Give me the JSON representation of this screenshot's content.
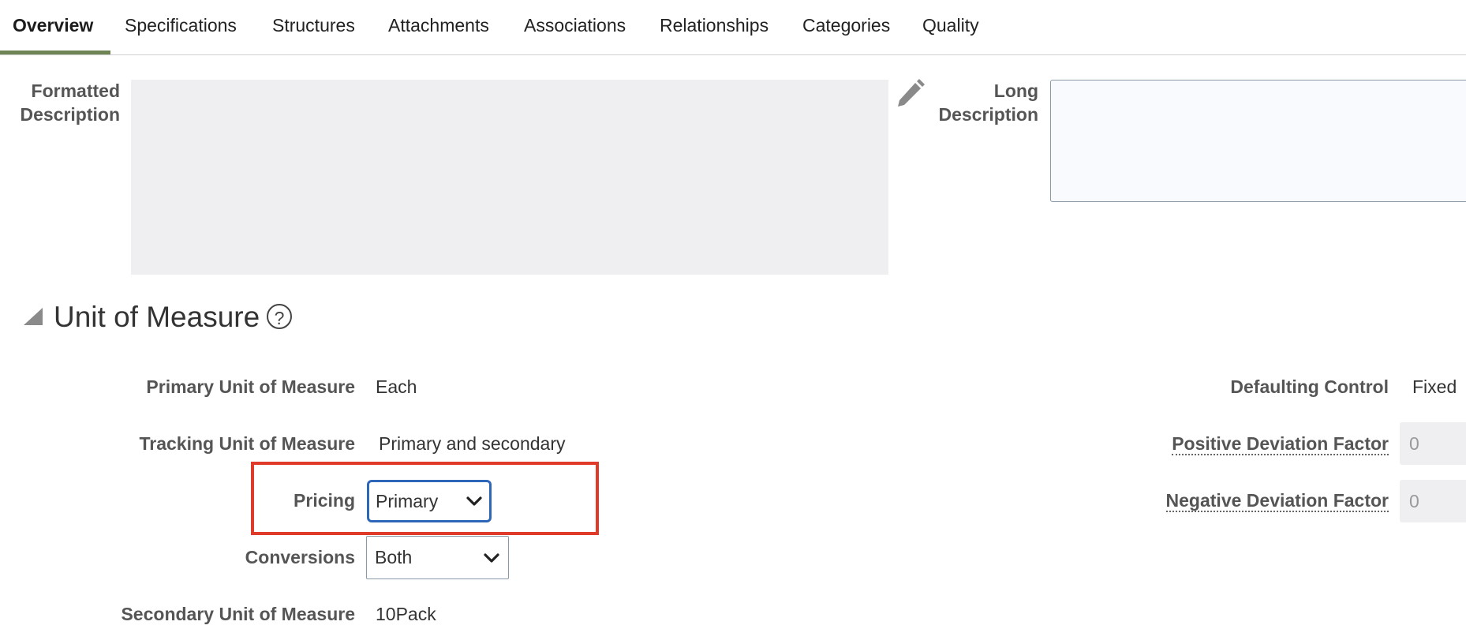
{
  "tabs": [
    {
      "label": "Overview",
      "active": true
    },
    {
      "label": "Specifications"
    },
    {
      "label": "Structures"
    },
    {
      "label": "Attachments"
    },
    {
      "label": "Associations"
    },
    {
      "label": "Relationships"
    },
    {
      "label": "Categories"
    },
    {
      "label": "Quality"
    }
  ],
  "descriptions": {
    "formatted_label_1": "Formatted",
    "formatted_label_2": "Description",
    "long_label_1": "Long",
    "long_label_2": "Description",
    "long_value": ""
  },
  "section": {
    "title": "Unit of Measure",
    "help_symbol": "?"
  },
  "uom": {
    "primary_label": "Primary Unit of Measure",
    "primary_value": "Each",
    "tracking_label": "Tracking Unit of Measure",
    "tracking_value": "Primary and secondary",
    "pricing_label": "Pricing",
    "pricing_value": "Primary",
    "conversions_label": "Conversions",
    "conversions_value": "Both",
    "secondary_label": "Secondary Unit of Measure",
    "secondary_value": "10Pack",
    "defaulting_label": "Defaulting Control",
    "defaulting_value": "Fixed",
    "positive_label": "Positive Deviation Factor",
    "positive_value": "0",
    "negative_label": "Negative Deviation Factor",
    "negative_value": "0"
  },
  "colors": {
    "active_tab_underline": "#6e8455",
    "focus_border": "#2f67b8",
    "highlight": "#e03a2a",
    "readonly_fill": "#efeff1"
  },
  "icons": [
    "pencil-icon",
    "collapse-triangle-icon",
    "help-icon",
    "chevron-down-icon"
  ]
}
